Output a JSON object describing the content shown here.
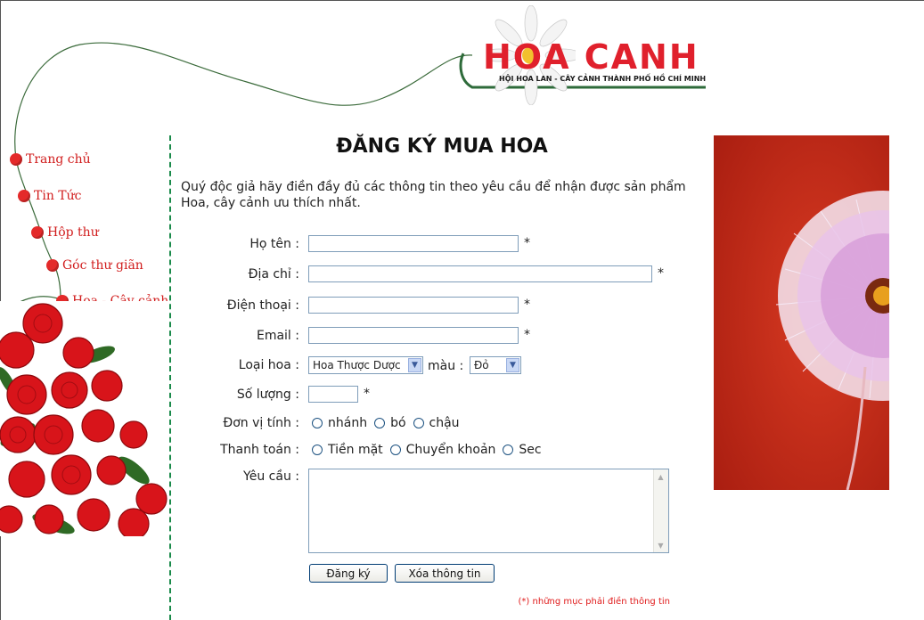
{
  "header": {
    "logo_text": "HOA CANH",
    "logo_subtitle": "HỘI HOA LAN - CÂY CẢNH THÀNH PHỐ HỒ CHÍ MINH"
  },
  "sidebar": {
    "items": [
      {
        "label": "Trang chủ"
      },
      {
        "label": "Tin Tức"
      },
      {
        "label": "Hộp thư"
      },
      {
        "label": "Góc thư giãn"
      },
      {
        "label": "Hoa - Cây cảnh"
      }
    ]
  },
  "main": {
    "title": "ĐĂNG KÝ MUA HOA",
    "intro": "Quý độc giả hãy điền đầy đủ các thông tin theo yêu cầu để nhận được sản phẩm Hoa, cây cảnh ưu thích nhất.",
    "required_mark": "*",
    "fields": {
      "name_label": "Họ tên :",
      "address_label": "Địa chỉ :",
      "phone_label": "Điện thoại :",
      "email_label": "Email :",
      "type_label": "Loại hoa :",
      "type_selected": "Hoa Thược Dược",
      "color_label": "màu :",
      "color_selected": "Đỏ",
      "quantity_label": "Số lượng :",
      "unit_label": "Đơn vị tính :",
      "unit_options": [
        "nhánh",
        "bó",
        "chậu"
      ],
      "payment_label": "Thanh toán :",
      "payment_options": [
        "Tiền mặt",
        "Chuyển khoản",
        "Sec"
      ],
      "request_label": "Yêu cầu :"
    },
    "buttons": {
      "submit": "Đăng ký",
      "reset": "Xóa thông tin"
    },
    "note": "(*) những mục phải điền thông tin"
  },
  "colors": {
    "accent_red": "#e0202c",
    "divider_green": "#1a8a4a",
    "input_border": "#7f9db9"
  }
}
